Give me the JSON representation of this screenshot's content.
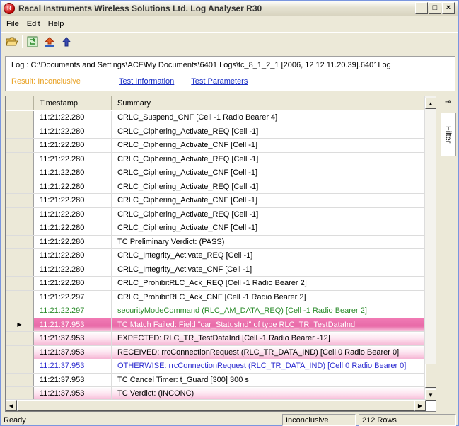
{
  "window": {
    "title": "Racal Instruments Wireless Solutions Ltd. Log Analyser R30",
    "min": "_",
    "max": "□",
    "close": "×"
  },
  "menu": [
    {
      "label": "File"
    },
    {
      "label": "Edit"
    },
    {
      "label": "Help"
    }
  ],
  "toolbar": {
    "icons": [
      "open-folder-icon",
      "refresh-icon",
      "upload-icon",
      "up-arrow-icon"
    ]
  },
  "info": {
    "log_label": "Log : C:\\Documents and Settings\\ACE\\My Documents\\6401 Logs\\tc_8_1_2_1 [2006, 12 12  11.20.39].6401Log",
    "result": "Result: Inconclusive",
    "test_information": "Test Information",
    "test_parameters": "Test Parameters"
  },
  "grid": {
    "columns": [
      "Timestamp",
      "Summary"
    ],
    "rows": [
      {
        "ts": "11:21:22.280",
        "summary": "CRLC_Suspend_CNF [Cell -1 Radio Bearer 4]",
        "style": ""
      },
      {
        "ts": "11:21:22.280",
        "summary": "CRLC_Ciphering_Activate_REQ [Cell -1]",
        "style": ""
      },
      {
        "ts": "11:21:22.280",
        "summary": "CRLC_Ciphering_Activate_CNF [Cell -1]",
        "style": ""
      },
      {
        "ts": "11:21:22.280",
        "summary": "CRLC_Ciphering_Activate_REQ [Cell -1]",
        "style": ""
      },
      {
        "ts": "11:21:22.280",
        "summary": "CRLC_Ciphering_Activate_CNF [Cell -1]",
        "style": ""
      },
      {
        "ts": "11:21:22.280",
        "summary": "CRLC_Ciphering_Activate_REQ [Cell -1]",
        "style": ""
      },
      {
        "ts": "11:21:22.280",
        "summary": "CRLC_Ciphering_Activate_CNF [Cell -1]",
        "style": ""
      },
      {
        "ts": "11:21:22.280",
        "summary": "CRLC_Ciphering_Activate_REQ [Cell -1]",
        "style": ""
      },
      {
        "ts": "11:21:22.280",
        "summary": "CRLC_Ciphering_Activate_CNF [Cell -1]",
        "style": ""
      },
      {
        "ts": "11:21:22.280",
        "summary": "TC Preliminary Verdict: (PASS)",
        "style": ""
      },
      {
        "ts": "11:21:22.280",
        "summary": "CRLC_Integrity_Activate_REQ [Cell -1]",
        "style": ""
      },
      {
        "ts": "11:21:22.280",
        "summary": "CRLC_Integrity_Activate_CNF [Cell -1]",
        "style": ""
      },
      {
        "ts": "11:21:22.280",
        "summary": "CRLC_ProhibitRLC_Ack_REQ [Cell -1 Radio Bearer 2]",
        "style": ""
      },
      {
        "ts": "11:21:22.297",
        "summary": "CRLC_ProhibitRLC_Ack_CNF [Cell -1 Radio Bearer 2]",
        "style": ""
      },
      {
        "ts": "11:21:22.297",
        "summary": "securityModeCommand (RLC_AM_DATA_REQ) [Cell -1 Radio Bearer 2]",
        "style": "green"
      },
      {
        "ts": "11:21:37.953",
        "summary": "TC Match Failed: Field \"car_StatusInd\" of type RLC_TR_TestDataInd",
        "style": "pink-hi",
        "marker": "▶"
      },
      {
        "ts": "11:21:37.953",
        "summary": "EXPECTED: RLC_TR_TestDataInd [Cell -1 Radio Bearer -12]",
        "style": "pink"
      },
      {
        "ts": "11:21:37.953",
        "summary": "RECEIVED: rrcConnectionRequest (RLC_TR_DATA_IND) [Cell 0 Radio Bearer 0]",
        "style": "pink"
      },
      {
        "ts": "11:21:37.953",
        "summary": "OTHERWISE: rrcConnectionRequest (RLC_TR_DATA_IND) [Cell 0 Radio Bearer 0]",
        "style": "blue"
      },
      {
        "ts": "11:21:37.953",
        "summary": "TC Cancel Timer: t_Guard [300] 300 s",
        "style": ""
      },
      {
        "ts": "11:21:37.953",
        "summary": "TC Verdict: (INCONC)",
        "style": "pink"
      }
    ]
  },
  "side": {
    "pin": "⊸",
    "filter_tab": "Filter"
  },
  "status": {
    "ready": "Ready",
    "verdict": "Inconclusive",
    "rows": "212 Rows"
  },
  "colors": {
    "highlight_pink": "#e86aa8",
    "light_pink": "#f6b6d4",
    "green_text": "#2a8a2a",
    "blue_text": "#2a2acf",
    "result_orange": "#e8a020",
    "link_blue": "#1a2ec4"
  }
}
